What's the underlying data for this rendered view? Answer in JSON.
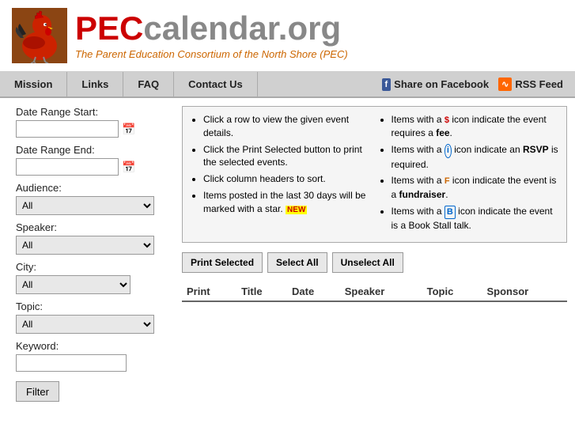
{
  "header": {
    "title_pec": "PEC",
    "title_calendar": "calendar.org",
    "subtitle": "The Parent Education Consortium of the North Shore (PEC)"
  },
  "navbar": {
    "items": [
      {
        "id": "mission",
        "label": "Mission"
      },
      {
        "id": "links",
        "label": "Links"
      },
      {
        "id": "faq",
        "label": "FAQ"
      },
      {
        "id": "contact",
        "label": "Contact Us"
      }
    ],
    "social": {
      "facebook_label": "Share on Facebook",
      "rss_label": "RSS Feed"
    }
  },
  "sidebar": {
    "date_range_start_label": "Date Range Start:",
    "date_range_end_label": "Date Range End:",
    "audience_label": "Audience:",
    "speaker_label": "Speaker:",
    "city_label": "City:",
    "topic_label": "Topic:",
    "keyword_label": "Keyword:",
    "filter_btn": "Filter",
    "audience_options": [
      "All"
    ],
    "speaker_options": [
      "All"
    ],
    "city_options": [
      "All"
    ],
    "topic_options": [
      "All"
    ]
  },
  "info": {
    "col1": [
      "Click a row to view the given event details.",
      "Click the Print Selected button to print the selected events.",
      "Click column headers to sort.",
      "Items posted in the last 30 days will be marked with a star."
    ],
    "col2": [
      "Items with a $ icon indicate the event requires a fee.",
      "Items with a i icon indicate an RSVP is required.",
      "Items with a F icon indicate the event is a fundraiser.",
      "Items with a B icon indicate the event is a Book Stall talk."
    ]
  },
  "action_buttons": {
    "print_selected": "Print Selected",
    "select_all": "Select All",
    "unselect_all": "Unselect All"
  },
  "table": {
    "headers": [
      {
        "id": "print",
        "label": "Print"
      },
      {
        "id": "title",
        "label": "Title"
      },
      {
        "id": "date",
        "label": "Date"
      },
      {
        "id": "speaker",
        "label": "Speaker"
      },
      {
        "id": "topic",
        "label": "Topic"
      },
      {
        "id": "sponsor",
        "label": "Sponsor"
      }
    ]
  }
}
